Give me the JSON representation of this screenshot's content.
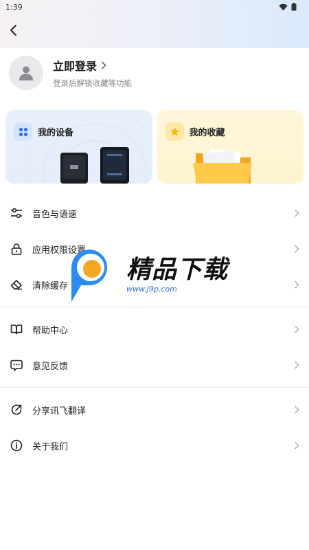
{
  "status_bar": {
    "time": "1:39",
    "icons": [
      "wifi-icon",
      "battery-icon"
    ]
  },
  "header": {
    "back_icon": "chevron-left-icon"
  },
  "profile": {
    "title": "立即登录",
    "subtitle": "登录后解锁收藏等功能"
  },
  "cards": {
    "device": {
      "title": "我的设备",
      "icon": "grid-dots-icon"
    },
    "favorites": {
      "title": "我的收藏",
      "icon": "star-icon"
    }
  },
  "menu": {
    "group1": [
      {
        "label": "音色与语速",
        "icon": "sliders-icon"
      },
      {
        "label": "应用权限设置",
        "icon": "lock-icon"
      },
      {
        "label": "清除缓存",
        "icon": "eraser-icon"
      }
    ],
    "group2": [
      {
        "label": "帮助中心",
        "icon": "book-icon"
      },
      {
        "label": "意见反馈",
        "icon": "chat-bubble-icon"
      }
    ],
    "group3": [
      {
        "label": "分享讯飞翻译",
        "icon": "share-icon"
      },
      {
        "label": "关于我们",
        "icon": "info-icon"
      }
    ]
  },
  "watermark": {
    "title": "精品下载",
    "url": "www.j9p.com"
  },
  "colors": {
    "accent_blue": "#3b7bf0",
    "star_yellow": "#f5b800",
    "arrow_gray": "#b0b0b0"
  }
}
